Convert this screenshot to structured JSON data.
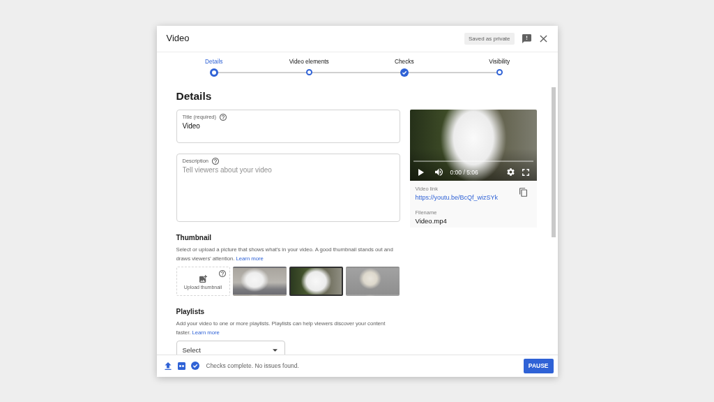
{
  "window": {
    "title": "Video",
    "status_chip": "Saved as private"
  },
  "steps": [
    {
      "label": "Details",
      "selected": true,
      "done": false
    },
    {
      "label": "Video elements",
      "selected": false,
      "done": false
    },
    {
      "label": "Checks",
      "selected": false,
      "done": true
    },
    {
      "label": "Visibility",
      "selected": false,
      "done": false
    }
  ],
  "details": {
    "heading": "Details",
    "title_field": {
      "label": "Title (required)",
      "value": "Video"
    },
    "description_field": {
      "label": "Description",
      "placeholder": "Tell viewers about your video"
    }
  },
  "thumbnail": {
    "heading": "Thumbnail",
    "description": "Select or upload a picture that shows what's in your video. A good thumbnail stands out and draws viewers' attention.",
    "link": "Learn more",
    "upload_label": "Upload thumbnail",
    "options": [
      {
        "selected": false
      },
      {
        "selected": true
      },
      {
        "selected": false
      }
    ]
  },
  "playlists": {
    "heading": "Playlists",
    "description": "Add your video to one or more playlists. Playlists can help viewers discover your content faster.",
    "link": "Learn more",
    "select": "Select"
  },
  "preview": {
    "time": "0:00 / 5:06",
    "link_label": "Video link",
    "link": "https://youtu.be/BcQf_wizSYk",
    "filename_label": "Filename",
    "filename": "Video.mp4"
  },
  "footer": {
    "status": "Checks complete. No issues found.",
    "button": "PAUSE"
  }
}
